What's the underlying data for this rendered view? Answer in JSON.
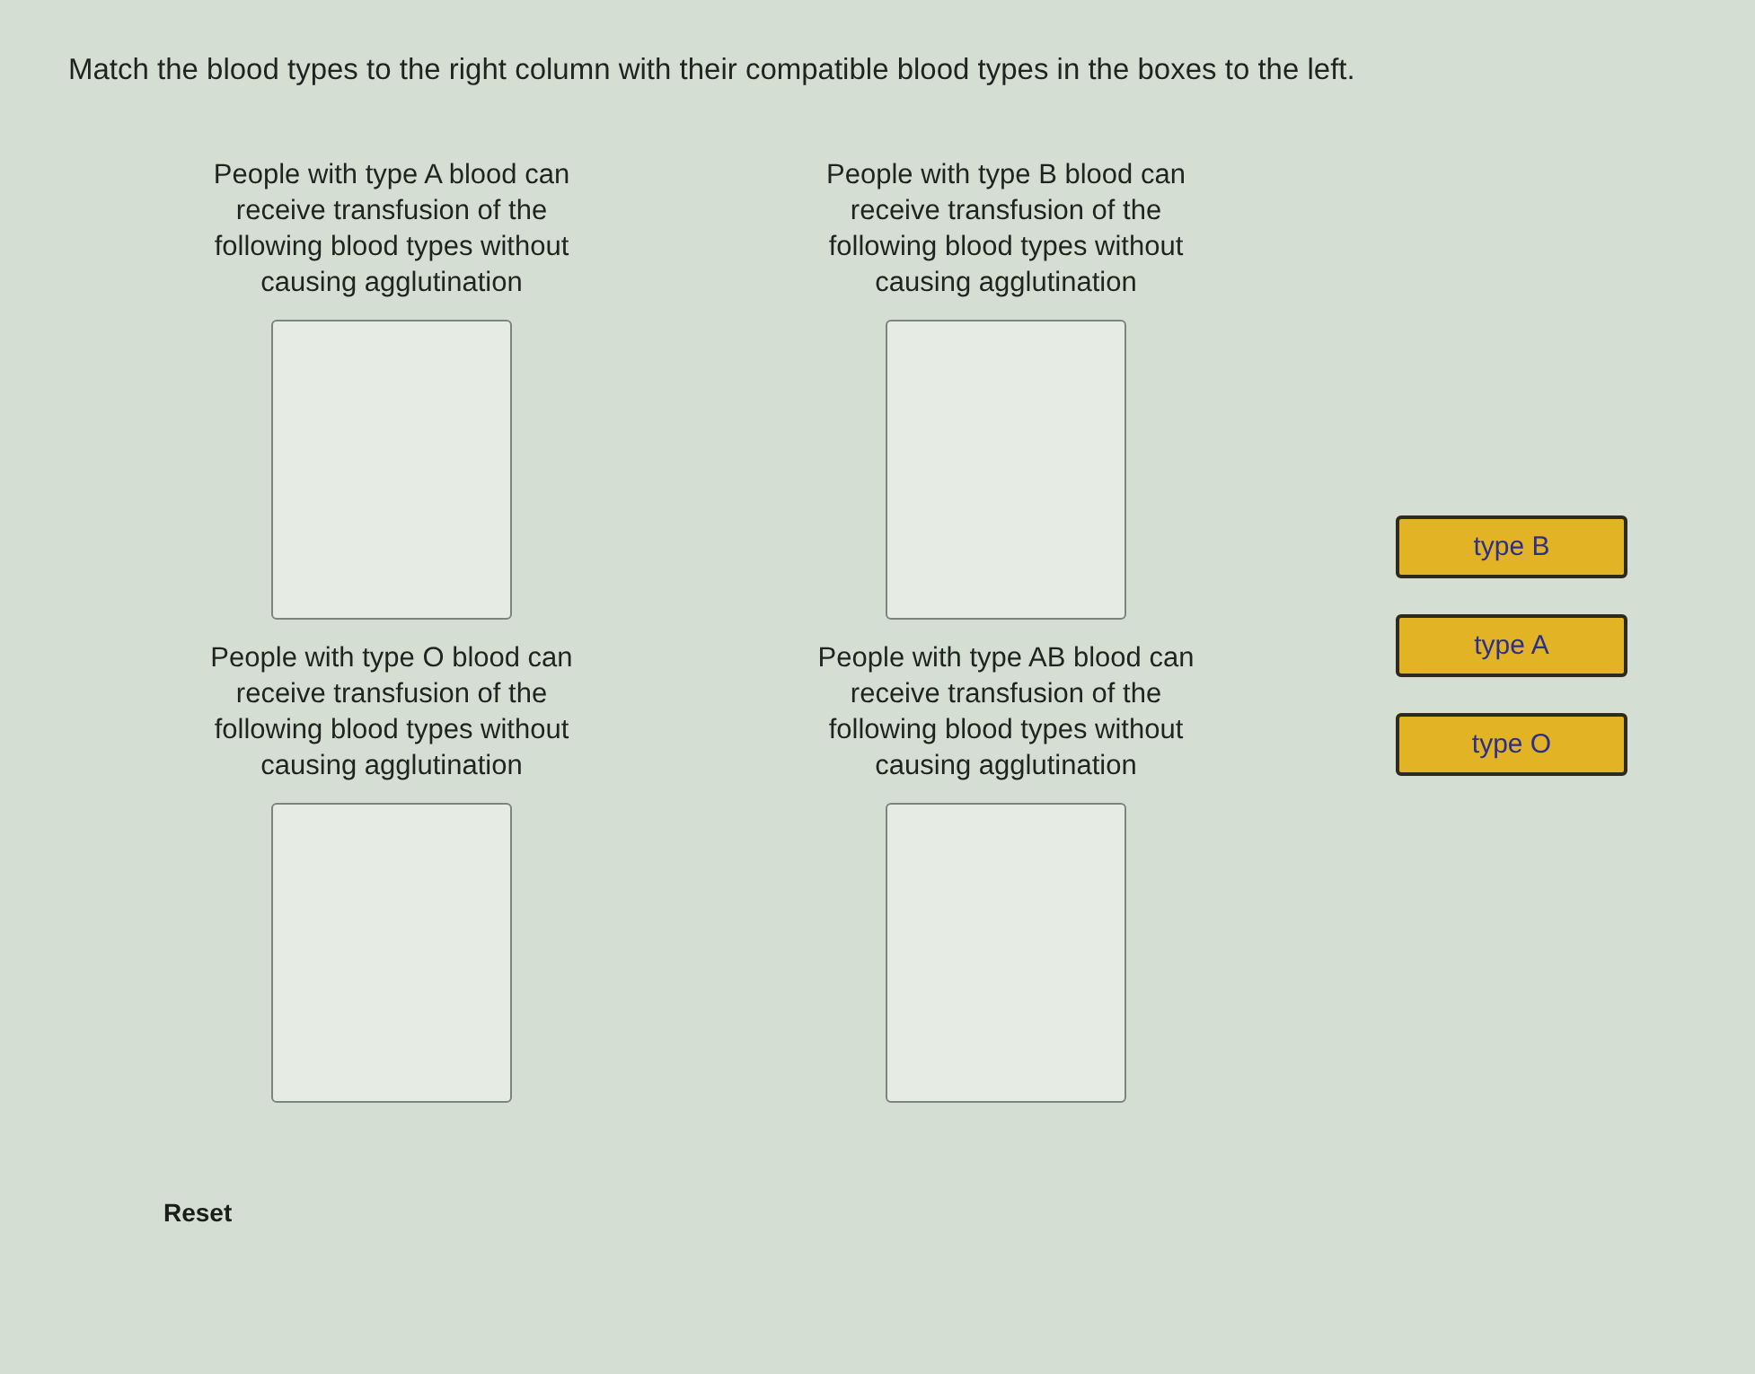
{
  "instruction": "Match the blood types to the right column with their compatible blood types in the boxes to the left.",
  "targets": [
    {
      "prompt": "People with type A blood can receive transfusion of the following blood types without causing agglutination"
    },
    {
      "prompt": "People with type B blood can receive transfusion of the following blood types without causing agglutination"
    },
    {
      "prompt": "People with type O blood can receive transfusion of the following blood types without causing agglutination"
    },
    {
      "prompt": "People with type AB blood can receive transfusion of the following blood types without causing agglutination"
    }
  ],
  "choices": [
    {
      "label": "type B"
    },
    {
      "label": "type A"
    },
    {
      "label": "type O"
    }
  ],
  "reset": "Reset"
}
